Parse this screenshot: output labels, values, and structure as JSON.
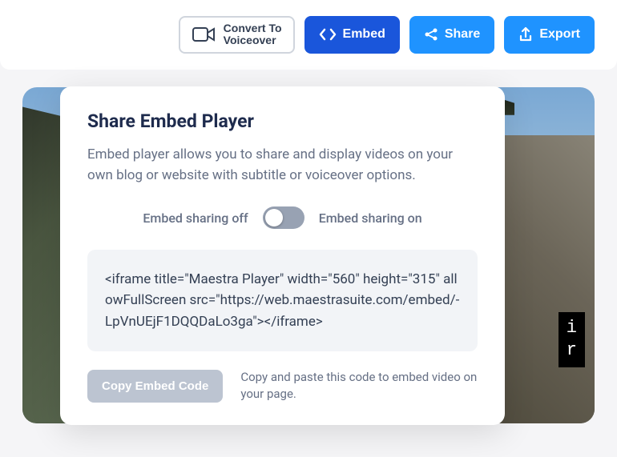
{
  "toolbar": {
    "convert_line1": "Convert To",
    "convert_line2": "Voiceover",
    "embed_label": "Embed",
    "share_label": "Share",
    "export_label": "Export"
  },
  "caption": {
    "line1": "i",
    "line2": "r"
  },
  "modal": {
    "title": "Share Embed Player",
    "description": "Embed player allows you to share and display videos on your own blog or website with subtitle or voiceover options.",
    "toggle_off_label": "Embed sharing off",
    "toggle_on_label": "Embed sharing on",
    "toggle_state": "off",
    "embed_code": "<iframe title=\"Maestra Player\" width=\"560\" height=\"315\" allowFullScreen src=\"https://web.maestrasuite.com/embed/-LpVnUEjF1DQQDaLo3ga\"></iframe>",
    "copy_button": "Copy Embed Code",
    "copy_hint": "Copy and paste this code to embed video on your page."
  }
}
